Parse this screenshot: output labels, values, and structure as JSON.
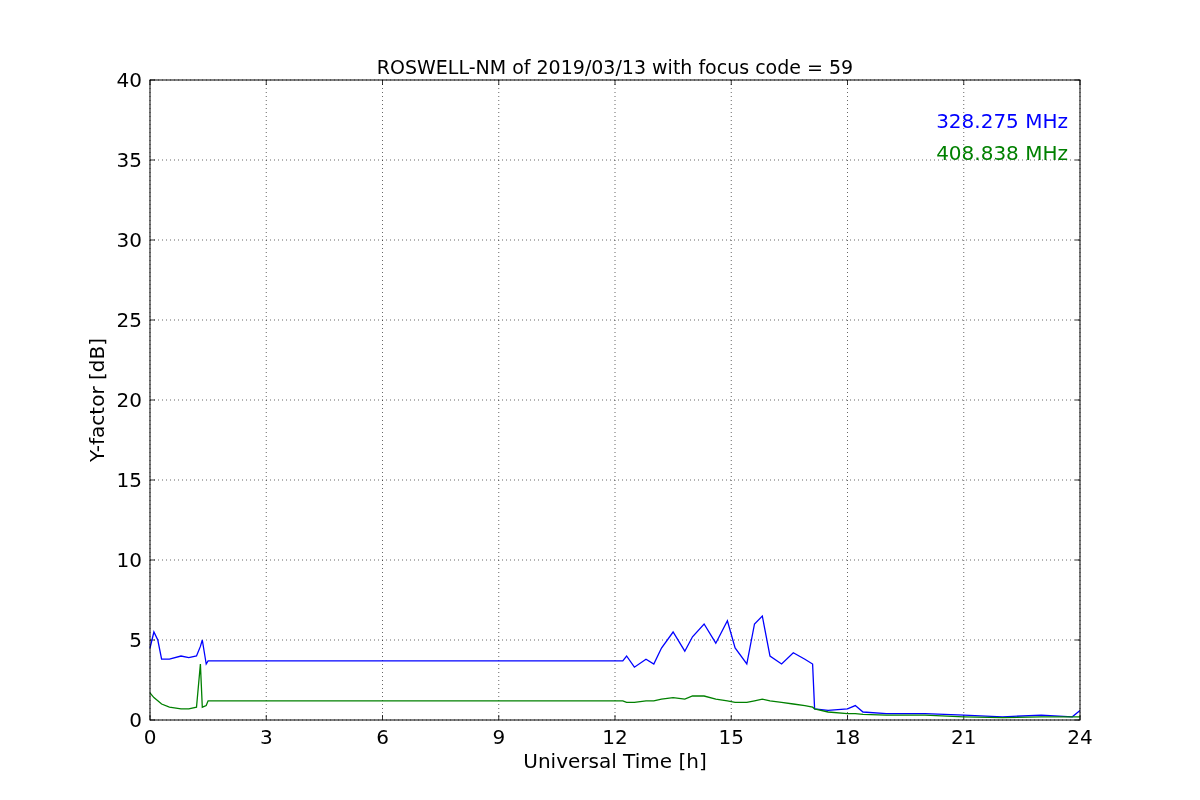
{
  "figure": {
    "chart_data": {
      "type": "line",
      "title": "ROSWELL-NM of 2019/03/13 with focus code = 59",
      "xlabel": "Universal Time [h]",
      "ylabel": "Y-factor [dB]",
      "x": [
        0,
        0.1,
        0.2,
        0.3,
        0.5,
        0.8,
        1.0,
        1.2,
        1.3,
        1.35,
        1.45,
        1.5,
        3,
        6,
        9,
        12.2,
        12.3,
        12.5,
        12.8,
        13.0,
        13.2,
        13.5,
        13.8,
        14.0,
        14.3,
        14.6,
        14.9,
        15.1,
        15.4,
        15.6,
        15.8,
        16.0,
        16.3,
        16.6,
        16.9,
        17.1,
        17.15,
        17.5,
        18,
        18.2,
        18.4,
        19,
        20,
        21,
        22,
        23,
        23.8,
        24
      ],
      "series": [
        {
          "name": "328.275 MHz",
          "color": "#0000ff",
          "values": [
            4.5,
            5.5,
            5.0,
            3.8,
            3.8,
            4.0,
            3.9,
            4.0,
            4.6,
            5.0,
            3.5,
            3.7,
            3.7,
            3.7,
            3.7,
            3.7,
            4.0,
            3.3,
            3.8,
            3.5,
            4.5,
            5.5,
            4.3,
            5.2,
            6.0,
            4.8,
            6.2,
            4.5,
            3.5,
            6.0,
            6.5,
            4.0,
            3.5,
            4.2,
            3.8,
            3.5,
            0.7,
            0.6,
            0.7,
            0.9,
            0.5,
            0.4,
            0.4,
            0.3,
            0.2,
            0.3,
            0.2,
            0.6
          ]
        },
        {
          "name": "408.838 MHz",
          "color": "#008000",
          "values": [
            1.7,
            1.4,
            1.2,
            1.0,
            0.8,
            0.7,
            0.7,
            0.8,
            3.5,
            0.8,
            0.9,
            1.2,
            1.2,
            1.2,
            1.2,
            1.2,
            1.1,
            1.1,
            1.2,
            1.2,
            1.3,
            1.4,
            1.3,
            1.5,
            1.5,
            1.3,
            1.2,
            1.1,
            1.1,
            1.2,
            1.3,
            1.2,
            1.1,
            1.0,
            0.9,
            0.8,
            0.7,
            0.5,
            0.4,
            0.4,
            0.35,
            0.3,
            0.3,
            0.2,
            0.15,
            0.2,
            0.2,
            0.2
          ]
        }
      ],
      "grid": true,
      "xlim": [
        0,
        24
      ],
      "ylim": [
        0,
        40
      ],
      "xticks": [
        0,
        3,
        6,
        9,
        12,
        15,
        18,
        21,
        24
      ],
      "yticks": [
        0,
        5,
        10,
        15,
        20,
        25,
        30,
        35,
        40
      ]
    }
  }
}
